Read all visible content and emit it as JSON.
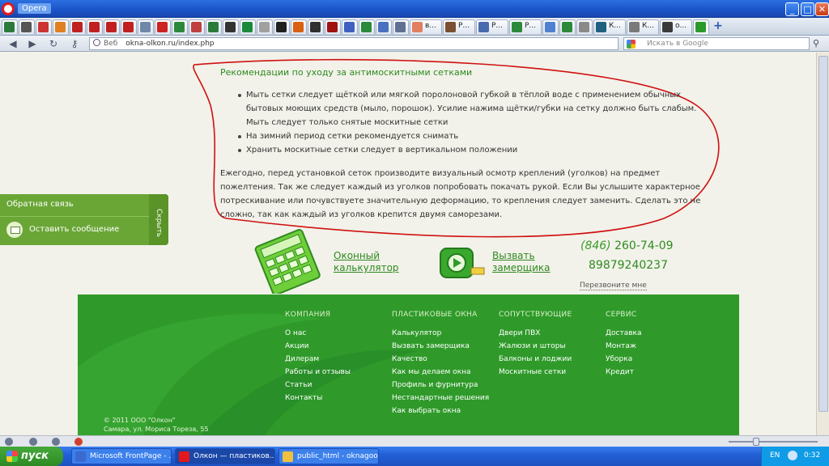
{
  "window": {
    "title": "Opera"
  },
  "tabs": [
    {
      "label": "",
      "color": "#2a7a3a"
    },
    {
      "label": "",
      "color": "#555"
    },
    {
      "label": "",
      "color": "#cc3333"
    },
    {
      "label": "",
      "color": "#e08020"
    },
    {
      "label": "",
      "color": "#c02020"
    },
    {
      "label": "",
      "color": "#c02020"
    },
    {
      "label": "",
      "color": "#c02020"
    },
    {
      "label": "",
      "color": "#c02020"
    },
    {
      "label": "",
      "color": "#7088a8"
    },
    {
      "label": "",
      "color": "#cc2222"
    },
    {
      "label": "",
      "color": "#2a8a3a"
    },
    {
      "label": "",
      "color": "#c04040"
    },
    {
      "label": "",
      "color": "#2a7a3a"
    },
    {
      "label": "",
      "color": "#333"
    },
    {
      "label": "",
      "color": "#1a8a3a"
    },
    {
      "label": "",
      "color": "#a0a0a0"
    },
    {
      "label": "",
      "color": "#202020"
    },
    {
      "label": "",
      "color": "#d86010"
    },
    {
      "label": "",
      "color": "#303030"
    },
    {
      "label": "",
      "color": "#a01010"
    },
    {
      "label": "",
      "color": "#4060c0"
    },
    {
      "label": "",
      "color": "#2a8a3a"
    },
    {
      "label": "",
      "color": "#4a70c0"
    },
    {
      "label": "",
      "color": "#607090"
    },
    {
      "label": "в...",
      "color": "#e08060"
    },
    {
      "label": "Р...",
      "color": "#7a5030"
    },
    {
      "label": "Р...",
      "color": "#4a6ab0"
    },
    {
      "label": "Р...",
      "color": "#2a8a3a"
    },
    {
      "label": "",
      "color": "#5080d0"
    },
    {
      "label": "",
      "color": "#2a8a3a"
    },
    {
      "label": "",
      "color": "#8a8a8a"
    },
    {
      "label": "К...",
      "color": "#206080"
    },
    {
      "label": "К...",
      "color": "#7a7a7a"
    },
    {
      "label": "о...",
      "color": "#3a3a3a"
    },
    {
      "label": "",
      "color": "#2a9a2a"
    }
  ],
  "address": {
    "prefix": "Веб",
    "url": "okna-olkon.ru/index.php"
  },
  "search": {
    "placeholder": "Искать в Google"
  },
  "content": {
    "care_title": "Рекомендации по уходу за антимоскитными сетками",
    "care_items": [
      "Мыть сетки следует щёткой или мягкой поролоновой губкой в тёплой воде с применением обычных",
      "бытовых моющих средств (мыло, порошок). Усилие нажима щётки/губки на сетку должно быть слабым.",
      "Мыть следует только снятые москитные сетки",
      "На зимний период сетки рекомендуется снимать",
      "Хранить москитные сетки следует в вертикальном положении"
    ],
    "paragraph": "Ежегодно, перед установкой сеток производите визуальный осмотр креплений (уголков) на предмет пожелтения. Так же следует каждый из уголков попробовать покачать рукой. Если Вы услышите характерное потрескивание или почувствуете значительную деформацию, то крепления следует заменить. Сделать это не сложно, так как каждый из уголков крепится двумя саморезами."
  },
  "feedback": {
    "title": "Обратная связь",
    "message": "Оставить сообщение",
    "hide": "Скрыть"
  },
  "calculator": {
    "label": "Оконный калькулятор"
  },
  "measurer": {
    "label": "Вызвать замерщика"
  },
  "contacts": {
    "phone_code": "(846)",
    "phone1": "260-74-09",
    "phone2": "89879240237",
    "callback": "Перезвоните мне"
  },
  "footer": {
    "columns": [
      {
        "heading": "КОМПАНИЯ",
        "links": [
          "О нас",
          "Акции",
          "Дилерам",
          "Работы и отзывы",
          "Статьи",
          "Контакты"
        ]
      },
      {
        "heading": "ПЛАСТИКОВЫЕ ОКНА",
        "links": [
          "Калькулятор",
          "Вызвать замерщика",
          "Качество",
          "Как мы делаем окна",
          "Профиль и фурнитура",
          "Нестандартные решения",
          "Как выбрать окна"
        ]
      },
      {
        "heading": "СОПУТСТВУЮЩИЕ",
        "links": [
          "Двери ПВХ",
          "Жалюзи и шторы",
          "Балконы и лоджии",
          "Москитные сетки"
        ]
      },
      {
        "heading": "СЕРВИС",
        "links": [
          "Доставка",
          "Монтаж",
          "Уборка",
          "Кредит"
        ]
      }
    ],
    "copyright": "© 2011 ООО \"Олкон\"",
    "address": "Самара, ул. Мориса Тореза, 55"
  },
  "taskbar": {
    "start": "пуск",
    "tasks": [
      {
        "label": "Microsoft FrontPage - ...",
        "color": "#3a6ad0"
      },
      {
        "label": "Олкон — пластиков...",
        "color": "#e2181d"
      },
      {
        "label": "public_html - oknagoo...",
        "color": "#f0c040"
      }
    ],
    "lang": "EN",
    "clock": "0:32"
  },
  "colors": {
    "brand_green": "#2f9a2a",
    "text_green": "#2f8a1f",
    "annotation_red": "#d01010"
  }
}
